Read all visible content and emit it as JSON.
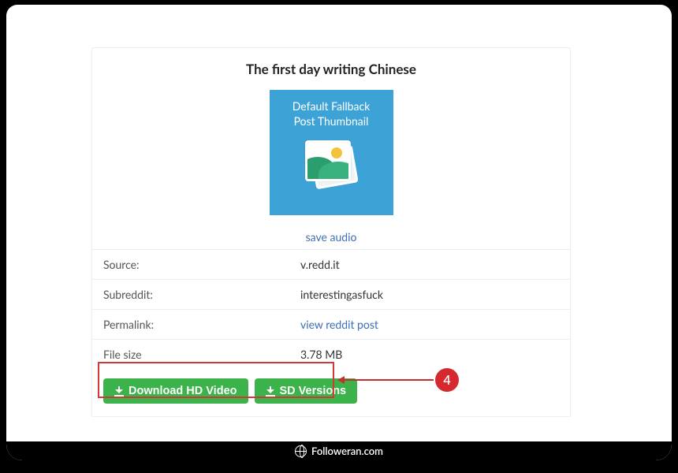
{
  "card": {
    "title": "The first day writing Chinese",
    "thumbnail_text_line1": "Default Fallback",
    "thumbnail_text_line2": "Post Thumbnail",
    "save_audio_label": "save audio",
    "meta": {
      "source": {
        "label": "Source:",
        "value": "v.redd.it"
      },
      "subreddit": {
        "label": "Subreddit:",
        "value": "interestingasfuck"
      },
      "permalink": {
        "label": "Permalink:",
        "link_text": "view reddit post"
      },
      "filesize": {
        "label": "File size",
        "value": "3.78 MB"
      }
    },
    "buttons": {
      "hd": "Download HD Video",
      "sd": "SD Versions"
    }
  },
  "annotation": {
    "step": "4"
  },
  "footer": {
    "site": "Followeran.com"
  }
}
